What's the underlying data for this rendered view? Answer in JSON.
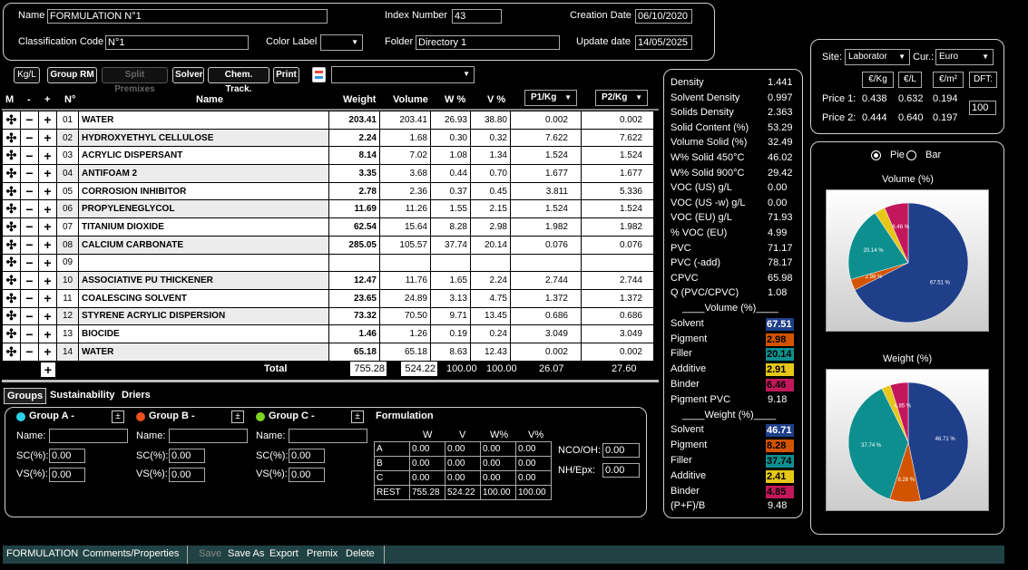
{
  "header": {
    "name_label": "Name",
    "name_value": "FORMULATION N°1",
    "index_label": "Index Number",
    "index_value": "43",
    "creation_label": "Creation Date",
    "creation_value": "06/10/2020",
    "class_label": "Classification Code",
    "class_value": "N°1",
    "color_label": "Color Label",
    "folder_label": "Folder",
    "folder_value": "Directory 1",
    "update_label": "Update date",
    "update_value": "14/05/2025"
  },
  "toolbar": {
    "kgl": "Kg/L",
    "group_rm": "Group RM",
    "split_premixes": "Split Premixes",
    "solver": "Solver",
    "chem_track": "Chem. Track.",
    "print": "Print"
  },
  "columns": {
    "m": "M",
    "minus": "-",
    "plus": "+",
    "n": "N°",
    "name": "Name",
    "weight": "Weight",
    "volume": "Volume",
    "wpct": "W %",
    "vpct": "V %",
    "p1": "P1/Kg",
    "p2": "P2/Kg"
  },
  "rows": [
    {
      "n": "01",
      "name": "WATER",
      "w": "203.41",
      "v": "203.41",
      "wp": "26.93",
      "vp": "38.80",
      "p1": "0.002",
      "p2": "0.002"
    },
    {
      "n": "02",
      "name": "HYDROXYETHYL CELLULOSE",
      "w": "2.24",
      "v": "1.68",
      "wp": "0.30",
      "vp": "0.32",
      "p1": "7.622",
      "p2": "7.622"
    },
    {
      "n": "03",
      "name": "ACRYLIC DISPERSANT",
      "w": "8.14",
      "v": "7.02",
      "wp": "1.08",
      "vp": "1.34",
      "p1": "1.524",
      "p2": "1.524"
    },
    {
      "n": "04",
      "name": "ANTIFOAM 2",
      "w": "3.35",
      "v": "3.68",
      "wp": "0.44",
      "vp": "0.70",
      "p1": "1.677",
      "p2": "1.677"
    },
    {
      "n": "05",
      "name": "CORROSION INHIBITOR",
      "w": "2.78",
      "v": "2.36",
      "wp": "0.37",
      "vp": "0.45",
      "p1": "3.811",
      "p2": "5.336"
    },
    {
      "n": "06",
      "name": "PROPYLENEGLYCOL",
      "w": "11.69",
      "v": "11.26",
      "wp": "1.55",
      "vp": "2.15",
      "p1": "1.524",
      "p2": "1.524"
    },
    {
      "n": "07",
      "name": "TITANIUM DIOXIDE",
      "w": "62.54",
      "v": "15.64",
      "wp": "8.28",
      "vp": "2.98",
      "p1": "1.982",
      "p2": "1.982"
    },
    {
      "n": "08",
      "name": "CALCIUM CARBONATE",
      "w": "285.05",
      "v": "105.57",
      "wp": "37.74",
      "vp": "20.14",
      "p1": "0.076",
      "p2": "0.076"
    },
    {
      "n": "09",
      "name": "",
      "w": "",
      "v": "",
      "wp": "",
      "vp": "",
      "p1": "",
      "p2": ""
    },
    {
      "n": "10",
      "name": "ASSOCIATIVE PU THICKENER",
      "w": "12.47",
      "v": "11.76",
      "wp": "1.65",
      "vp": "2.24",
      "p1": "2.744",
      "p2": "2.744"
    },
    {
      "n": "11",
      "name": "COALESCING SOLVENT",
      "w": "23.65",
      "v": "24.89",
      "wp": "3.13",
      "vp": "4.75",
      "p1": "1.372",
      "p2": "1.372"
    },
    {
      "n": "12",
      "name": "STYRENE ACRYLIC DISPERSION",
      "w": "73.32",
      "v": "70.50",
      "wp": "9.71",
      "vp": "13.45",
      "p1": "0.686",
      "p2": "0.686"
    },
    {
      "n": "13",
      "name": "BIOCIDE",
      "w": "1.46",
      "v": "1.26",
      "wp": "0.19",
      "vp": "0.24",
      "p1": "3.049",
      "p2": "3.049"
    },
    {
      "n": "14",
      "name": "WATER",
      "w": "65.18",
      "v": "65.18",
      "wp": "8.63",
      "vp": "12.43",
      "p1": "0.002",
      "p2": "0.002"
    }
  ],
  "totals": {
    "label": "Total",
    "w": "755.28",
    "v": "524.22",
    "wp": "100.00",
    "vp": "100.00",
    "p1": "26.07",
    "p2": "27.60"
  },
  "props": [
    {
      "k": "Density",
      "v": "1.441"
    },
    {
      "k": "Solvent Density",
      "v": "0.997"
    },
    {
      "k": "Solids Density",
      "v": "2.363"
    },
    {
      "k": "Solid Content (%)",
      "v": "53.29"
    },
    {
      "k": "Volume Solid (%)",
      "v": "32.49"
    },
    {
      "k": "W% Solid 450°C",
      "v": "46.02"
    },
    {
      "k": "W% Solid 900°C",
      "v": "29.42"
    },
    {
      "k": "VOC (US) g/L",
      "v": "0.00"
    },
    {
      "k": "VOC (US -w) g/L",
      "v": "0.00"
    },
    {
      "k": "VOC (EU) g/L",
      "v": "71.93"
    },
    {
      "k": "% VOC (EU)",
      "v": "4.99"
    },
    {
      "k": "PVC",
      "v": "71.17"
    },
    {
      "k": "PVC (-add)",
      "v": "78.17"
    },
    {
      "k": "CPVC",
      "v": "65.98"
    },
    {
      "k": "Q (PVC/CPVC)",
      "v": "1.08"
    }
  ],
  "volume_header": "____Volume (%)____",
  "volume_items": [
    {
      "k": "Solvent",
      "v": "67.51",
      "c": "#1f3f8a"
    },
    {
      "k": "Pigment",
      "v": "2.98",
      "c": "#d35400"
    },
    {
      "k": "Filler",
      "v": "20.14",
      "c": "#0e8f8f"
    },
    {
      "k": "Additive",
      "v": "2.91",
      "c": "#e6c619"
    },
    {
      "k": "Binder",
      "v": "6.46",
      "c": "#c2185b"
    }
  ],
  "pigment_pvc": {
    "k": "Pigment PVC",
    "v": "9.18"
  },
  "weight_header": "____Weight (%)____",
  "weight_items": [
    {
      "k": "Solvent",
      "v": "46.71",
      "c": "#1f3f8a"
    },
    {
      "k": "Pigment",
      "v": "8.28",
      "c": "#d35400"
    },
    {
      "k": "Filler",
      "v": "37.74",
      "c": "#0e8f8f"
    },
    {
      "k": "Additive",
      "v": "2.41",
      "c": "#e6c619"
    },
    {
      "k": "Binder",
      "v": "4.85",
      "c": "#c2185b"
    }
  ],
  "pfb": {
    "k": "(P+F)/B",
    "v": "9.48"
  },
  "site": {
    "site_label": "Site:",
    "site_value": "Laborator",
    "cur_label": "Cur.:",
    "cur_value": "Euro",
    "h_kg": "€/Kg",
    "h_l": "€/L",
    "h_m2": "€/m²",
    "dft": "DFT:",
    "price1_label": "Price 1:",
    "p1kg": "0.438",
    "p1l": "0.632",
    "p1m2": "0.194",
    "price2_label": "Price 2:",
    "p2kg": "0.444",
    "p2l": "0.640",
    "p2m2": "0.197",
    "dft_value": "100"
  },
  "charts_panel": {
    "pie": "Pie",
    "bar": "Bar",
    "volume_title": "Volume (%)",
    "weight_title": "Weight (%)"
  },
  "chart_data": [
    {
      "type": "pie",
      "title": "Volume (%)",
      "labels": [
        "Solvent",
        "Pigment",
        "Filler",
        "Additive",
        "Binder"
      ],
      "values": [
        67.51,
        2.98,
        20.14,
        2.91,
        6.46
      ],
      "slice_labels": [
        "67.51 %",
        "2.98 %",
        "20.14 %",
        "",
        "6.46 %"
      ],
      "colors": [
        "#1f3f8a",
        "#d35400",
        "#0e8f8f",
        "#e6c619",
        "#c2185b"
      ]
    },
    {
      "type": "pie",
      "title": "Weight (%)",
      "labels": [
        "Solvent",
        "Pigment",
        "Filler",
        "Additive",
        "Binder"
      ],
      "values": [
        46.71,
        8.28,
        37.74,
        2.41,
        4.85
      ],
      "slice_labels": [
        "46.71 %",
        "8.28 %",
        "37.74 %",
        "",
        "4.85 %"
      ],
      "colors": [
        "#1f3f8a",
        "#d35400",
        "#0e8f8f",
        "#e6c619",
        "#c2185b"
      ]
    }
  ],
  "tabs": {
    "groups": "Groups",
    "sustainability": "Sustainability",
    "driers": "Driers"
  },
  "groups": {
    "a": "Group A -",
    "b": "Group B -",
    "c": "Group C -",
    "pm": "±",
    "name": "Name:",
    "sc": "SC(%):",
    "vs": "VS(%):",
    "zero": "0.00",
    "a_color": "#29d3e6",
    "b_color": "#e8501e",
    "c_color": "#7ed321"
  },
  "formulation": {
    "title": "Formulation",
    "headers": [
      "W",
      "V",
      "W%",
      "V%"
    ],
    "rows": [
      {
        "k": "A",
        "vals": [
          "0.00",
          "0.00",
          "0.00",
          "0.00"
        ]
      },
      {
        "k": "B",
        "vals": [
          "0.00",
          "0.00",
          "0.00",
          "0.00"
        ]
      },
      {
        "k": "C",
        "vals": [
          "0.00",
          "0.00",
          "0.00",
          "0.00"
        ]
      },
      {
        "k": "REST",
        "vals": [
          "755.28",
          "524.22",
          "100.00",
          "100.00"
        ]
      }
    ],
    "nco_label": "NCO/OH:",
    "nco_value": "0.00",
    "nh_label": "NH/Epx:",
    "nh_value": "0.00"
  },
  "bottom": {
    "formulation": "FORMULATION",
    "comments": "Comments/Properties",
    "save": "Save",
    "save_as": "Save As",
    "export": "Export",
    "premix": "Premix",
    "delete": "Delete"
  }
}
